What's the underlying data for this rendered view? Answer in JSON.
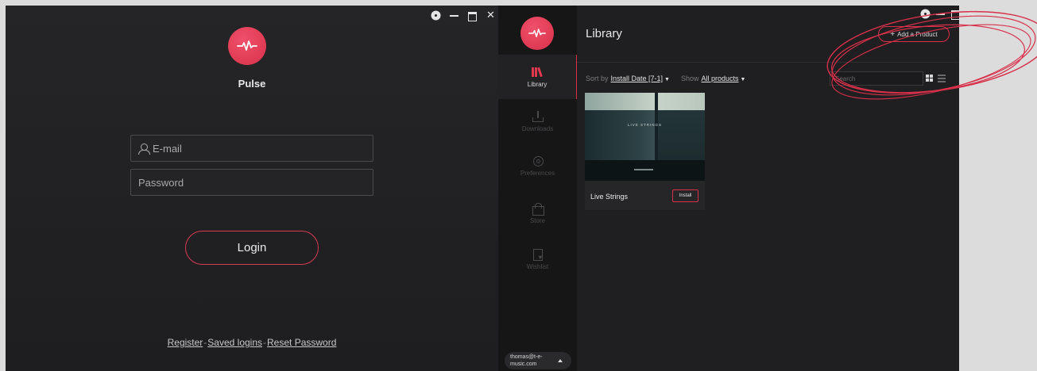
{
  "login": {
    "app_name": "Pulse",
    "email_placeholder": "E-mail",
    "password_placeholder": "Password",
    "login_label": "Login",
    "links": {
      "register": "Register",
      "saved_logins": "Saved logins",
      "reset_password": "Reset Password",
      "separator": "-"
    }
  },
  "library": {
    "title": "Library",
    "add_product_label": "Add a Product",
    "sort_label": "Sort by",
    "sort_value": "Install Date [7-1]",
    "show_label": "Show",
    "show_value": "All products",
    "search_placeholder": "Search",
    "sidebar": {
      "items": [
        {
          "label": "Library",
          "icon": "books-icon"
        },
        {
          "label": "Downloads",
          "icon": "download-icon"
        },
        {
          "label": "Preferences",
          "icon": "gear-icon"
        },
        {
          "label": "Store",
          "icon": "store-icon"
        },
        {
          "label": "Wishlist",
          "icon": "wishlist-icon"
        }
      ],
      "user_email": "thomas@t-e-music.com"
    },
    "products": [
      {
        "name": "Live Strings",
        "cover_text": "LIVE STRINGS",
        "action": "Install"
      }
    ]
  },
  "colors": {
    "accent": "#d8304a",
    "window_bg": "#1f1f21",
    "page_bg": "#dcdcdc"
  }
}
